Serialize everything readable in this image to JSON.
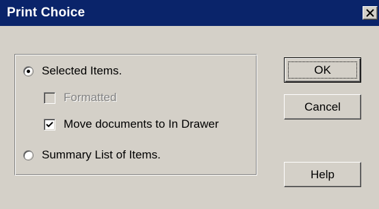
{
  "dialog": {
    "title": "Print Choice"
  },
  "options": {
    "selected_items_label": "Selected Items.",
    "formatted_label": "Formatted",
    "move_documents_label": "Move documents to In Drawer",
    "summary_list_label": "Summary List of Items."
  },
  "state": {
    "selected_option": "Selected Items.",
    "formatted_checked": false,
    "formatted_enabled": false,
    "move_documents_checked": true
  },
  "buttons": {
    "ok_label": "OK",
    "cancel_label": "Cancel",
    "help_label": "Help"
  },
  "colors": {
    "title_bar": "#0a246a",
    "dialog_face": "#d4d0c8"
  }
}
